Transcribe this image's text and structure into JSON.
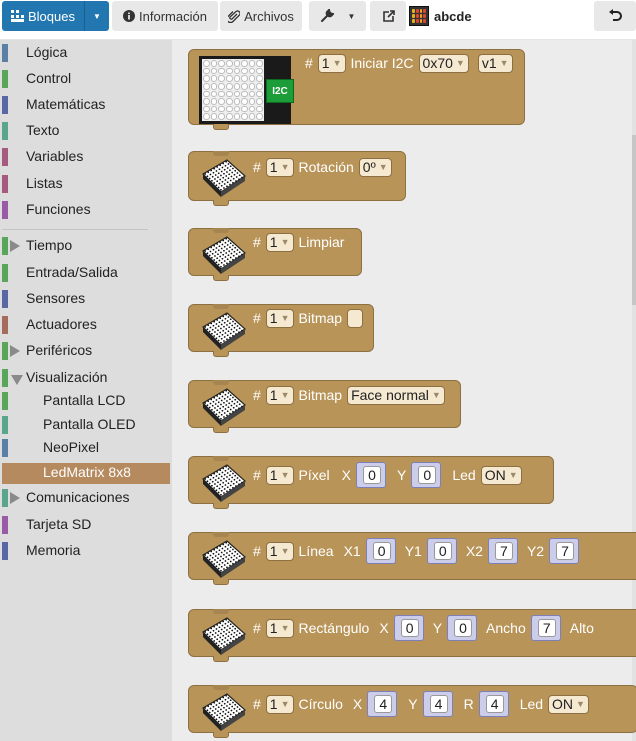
{
  "toolbar": {
    "bloques": "Bloques",
    "informacion": "Información",
    "archivos": "Archivos",
    "project_name": "abcde",
    "icons": {
      "bloques": "blocks-icon",
      "info": "info-icon",
      "archivos": "paperclip-icon",
      "tools": "wrench-icon",
      "share": "share-icon",
      "undo": "undo-icon"
    },
    "accent_color": "#2277b0"
  },
  "sidebar": {
    "categories": [
      {
        "label": "Lógica",
        "color": "#5b80a5"
      },
      {
        "label": "Control",
        "color": "#5ba55b"
      },
      {
        "label": "Matemáticas",
        "color": "#5b67a5"
      },
      {
        "label": "Texto",
        "color": "#5ba58c"
      },
      {
        "label": "Variables",
        "color": "#a55b80"
      },
      {
        "label": "Listas",
        "color": "#a55b80"
      },
      {
        "label": "Funciones",
        "color": "#995ba5"
      },
      {
        "label": "Tiempo",
        "color": "#5ba55b",
        "expandable": true
      },
      {
        "label": "Entrada/Salida",
        "color": "#5ba55b"
      },
      {
        "label": "Sensores",
        "color": "#5b67a5"
      },
      {
        "label": "Actuadores",
        "color": "#a56b5b"
      },
      {
        "label": "Periféricos",
        "color": "#5ba55b",
        "expandable": true
      },
      {
        "label": "Visualización",
        "color": "#5ba55b",
        "expanded": true
      },
      {
        "label": "Pantalla LCD",
        "color": "#5ba55b"
      },
      {
        "label": "Pantalla OLED",
        "color": "#5ba58c"
      },
      {
        "label": "NeoPixel",
        "color": "#5b80a5"
      },
      {
        "label": "LedMatrix 8x8",
        "color": "#b58a5e",
        "selected": true
      },
      {
        "label": "Comunicaciones",
        "color": "#5ba58c",
        "expandable": true
      },
      {
        "label": "Tarjeta SD",
        "color": "#995ba5"
      },
      {
        "label": "Memoria",
        "color": "#5b67a5"
      }
    ]
  },
  "blocks": {
    "init": {
      "hash": "#",
      "index": "1",
      "label": "Iniciar I2C",
      "addr": "0x70",
      "version": "v1",
      "chip": "I2C"
    },
    "rotacion": {
      "hash": "#",
      "index": "1",
      "label": "Rotación",
      "angle": "0º"
    },
    "limpiar": {
      "hash": "#",
      "index": "1",
      "label": "Limpiar"
    },
    "bitmap1": {
      "hash": "#",
      "index": "1",
      "label": "Bitmap"
    },
    "bitmap2": {
      "hash": "#",
      "index": "1",
      "label": "Bitmap",
      "face": "Face normal"
    },
    "pixel": {
      "hash": "#",
      "index": "1",
      "label": "Píxel",
      "x_label": "X",
      "x": "0",
      "y_label": "Y",
      "y": "0",
      "led_label": "Led",
      "led": "ON"
    },
    "linea": {
      "hash": "#",
      "index": "1",
      "label": "Línea",
      "x1_label": "X1",
      "x1": "0",
      "y1_label": "Y1",
      "y1": "0",
      "x2_label": "X2",
      "x2": "7",
      "y2_label": "Y2",
      "y2": "7"
    },
    "rect": {
      "hash": "#",
      "index": "1",
      "label": "Rectángulo",
      "x_label": "X",
      "x": "0",
      "y_label": "Y",
      "y": "0",
      "ancho_label": "Ancho",
      "ancho": "7",
      "alto_label": "Alto"
    },
    "circulo": {
      "hash": "#",
      "index": "1",
      "label": "Círculo",
      "x_label": "X",
      "x": "4",
      "y_label": "Y",
      "y": "4",
      "r_label": "R",
      "r": "4",
      "led_label": "Led",
      "led": "ON"
    }
  },
  "colors": {
    "block": "#b99458",
    "workspace": "#ececec",
    "sidebar": "#dddddd",
    "selected": "#b58a5e"
  }
}
